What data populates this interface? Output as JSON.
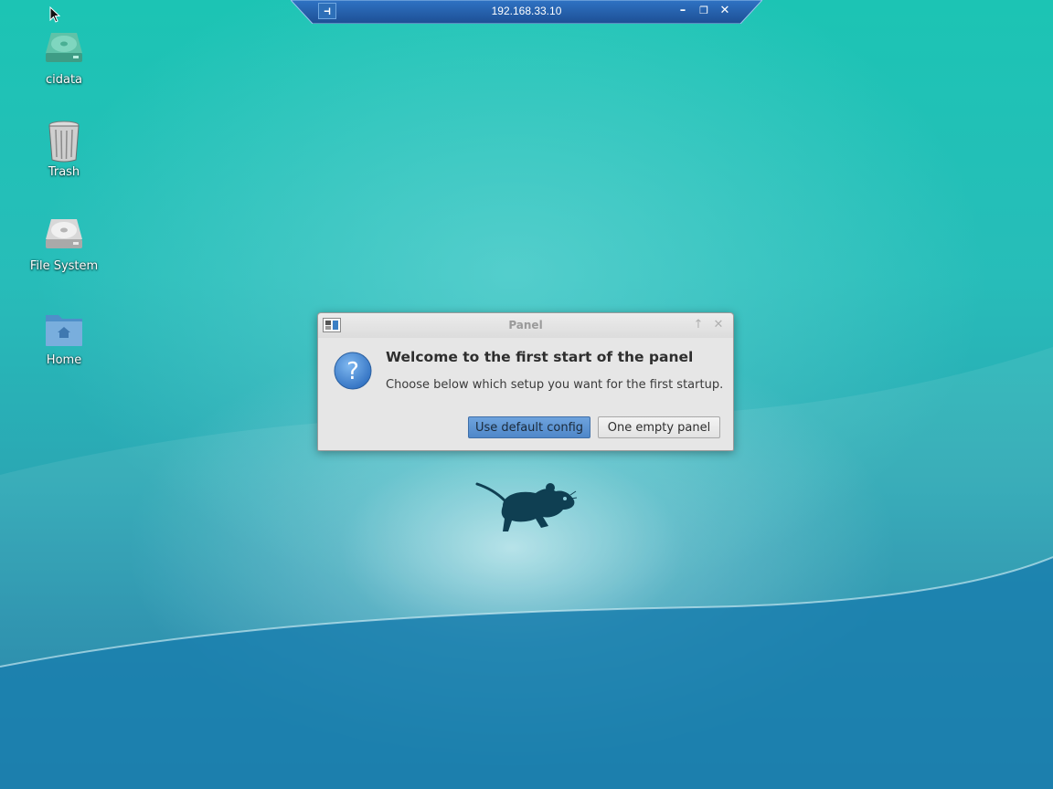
{
  "connection_bar": {
    "title": "192.168.33.10",
    "pin_glyph": "⊣",
    "minimize_glyph": "–",
    "restore_glyph": "❐",
    "close_glyph": "✕"
  },
  "desktop": {
    "icons": [
      {
        "label": "cidata",
        "icon": "drive-icon"
      },
      {
        "label": "Trash",
        "icon": "trash-icon"
      },
      {
        "label": "File System",
        "icon": "harddisk-icon"
      },
      {
        "label": "Home",
        "icon": "home-folder-icon"
      }
    ],
    "colors": {
      "top": "#1cc4b4",
      "bottom": "#1676a2"
    }
  },
  "dialog": {
    "title": "Panel",
    "heading": "Welcome to the first start of the panel",
    "body": "Choose below which setup you want for the first startup.",
    "primary_button": "Use default config",
    "secondary_button": "One empty panel",
    "up_glyph": "↑",
    "close_glyph": "✕",
    "question_glyph": "?"
  }
}
